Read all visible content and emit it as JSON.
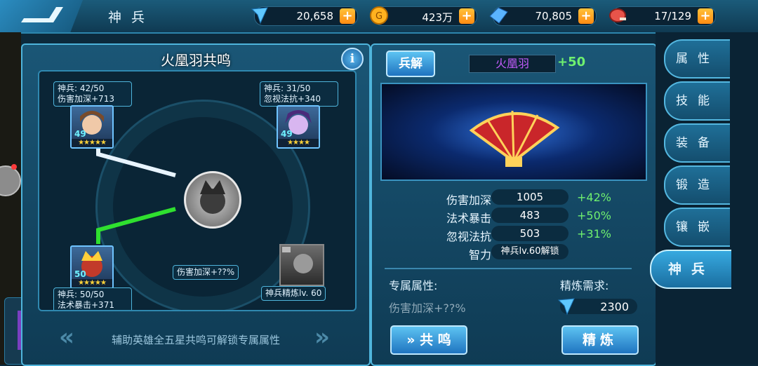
{
  "header": {
    "title": "神兵",
    "resources": [
      {
        "icon": "wing-icon",
        "value": "20,658"
      },
      {
        "icon": "gold-coin-icon",
        "value": "423万"
      },
      {
        "icon": "crystal-icon",
        "value": "70,805"
      },
      {
        "icon": "meat-stamina-icon",
        "value": "17/129"
      }
    ]
  },
  "resonance": {
    "title": "火凰羽共鸣",
    "slots": [
      {
        "line1": "神兵: 42/50",
        "line2": "伤害加深+713",
        "level": "49",
        "stars": "★★★★★"
      },
      {
        "line1": "神兵: 31/50",
        "line2": "忽视法抗+340",
        "level": "49",
        "stars": "★★★★"
      },
      {
        "line1": "神兵: 50/50",
        "line2": "法术暴击+371",
        "level": "50",
        "stars": "★★★★★"
      }
    ],
    "center_label": "伤害加深+??%",
    "forge_label": "神兵精炼lv. 60",
    "hint": "辅助英雄全五星共鸣可解锁专属属性"
  },
  "weapon": {
    "disassemble_label": "兵解",
    "name": "火凰羽",
    "plus": "+50",
    "stats": [
      {
        "label": "伤害加深",
        "value": "1005",
        "bonus": "+42%"
      },
      {
        "label": "法术暴击",
        "value": "483",
        "bonus": "+50%"
      },
      {
        "label": "忽视法抗",
        "value": "503",
        "bonus": "+31%"
      },
      {
        "label": "智力",
        "value": "神兵lv.60解锁",
        "bonus": ""
      }
    ],
    "exclusive_label": "专属属性:",
    "exclusive_value": "伤害加深+??%",
    "refine_req_label": "精炼需求:",
    "refine_cost": "2300",
    "resonate_label": "共 鸣",
    "refine_label": "精炼"
  },
  "side_tabs": [
    {
      "label": "属性",
      "active": false
    },
    {
      "label": "技能",
      "active": false
    },
    {
      "label": "装备",
      "active": false
    },
    {
      "label": "锻造",
      "active": false
    },
    {
      "label": "镶嵌",
      "active": false
    },
    {
      "label": "神兵",
      "active": true
    }
  ],
  "colors": {
    "accent": "#4fb5dc",
    "bonus_green": "#6ff06f",
    "weapon_name": "#c55cff",
    "plus_orange": "#ff8b12"
  }
}
